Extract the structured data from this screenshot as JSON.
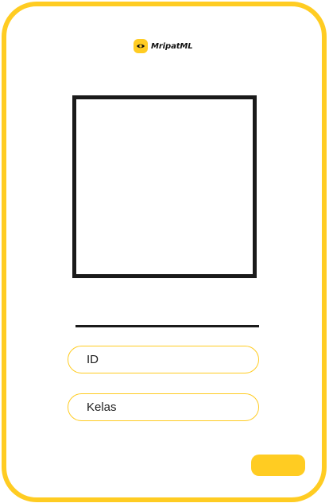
{
  "brand": {
    "name": "MripatML",
    "icon": "eye-logo-icon",
    "accent_color": "#ffcc22"
  },
  "photo": {
    "icon": "photo-frame"
  },
  "form": {
    "id_label": "ID",
    "kelas_label": "Kelas"
  },
  "actions": {
    "submit_label": ""
  },
  "colors": {
    "accent": "#ffcc22",
    "frame": "#1a1a1a",
    "background": "#ffffff"
  }
}
